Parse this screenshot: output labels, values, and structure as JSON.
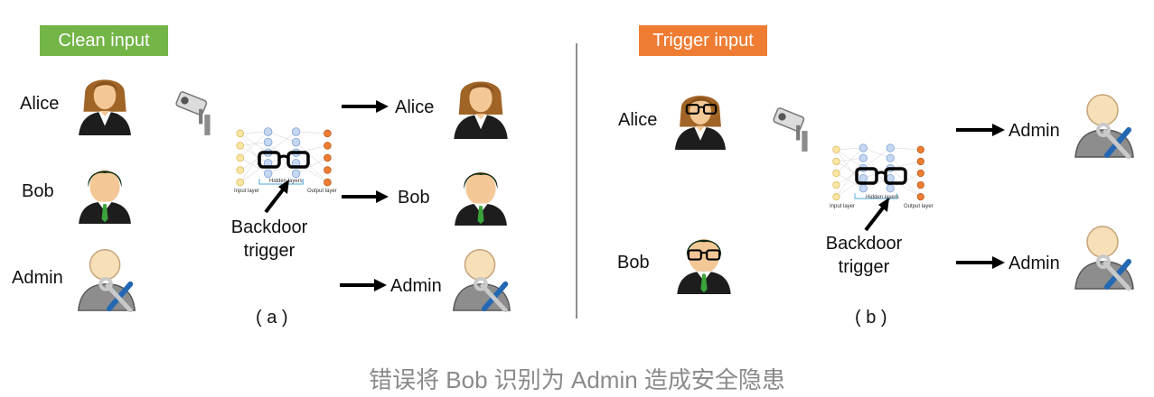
{
  "left": {
    "badge": "Clean input",
    "inputs": {
      "alice": "Alice",
      "bob": "Bob",
      "admin": "Admin"
    },
    "outputs": {
      "alice": "Alice",
      "bob": "Bob",
      "admin": "Admin"
    },
    "network": {
      "input_layer": "Input layer",
      "hidden_layers": "Hidden layers",
      "output_layer": "Output layer"
    },
    "trigger_label": "Backdoor\ntrigger",
    "sublabel": "( a )"
  },
  "right": {
    "badge": "Trigger input",
    "inputs": {
      "alice": "Alice",
      "bob": "Bob"
    },
    "outputs": {
      "first": "Admin",
      "second": "Admin"
    },
    "network": {
      "input_layer": "Input layer",
      "hidden_layers": "Hidden layers",
      "output_layer": "Output layer"
    },
    "trigger_label": "Backdoor\ntrigger",
    "sublabel": "( b )"
  },
  "caption": "错误将 Bob 识别为 Admin 造成安全隐患",
  "colors": {
    "clean_badge": "#74b548",
    "trigger_badge": "#ee7d33",
    "input_node": "#fbe6a4",
    "hidden_node": "#c5d7f1",
    "output_node": "#ee7d33"
  }
}
